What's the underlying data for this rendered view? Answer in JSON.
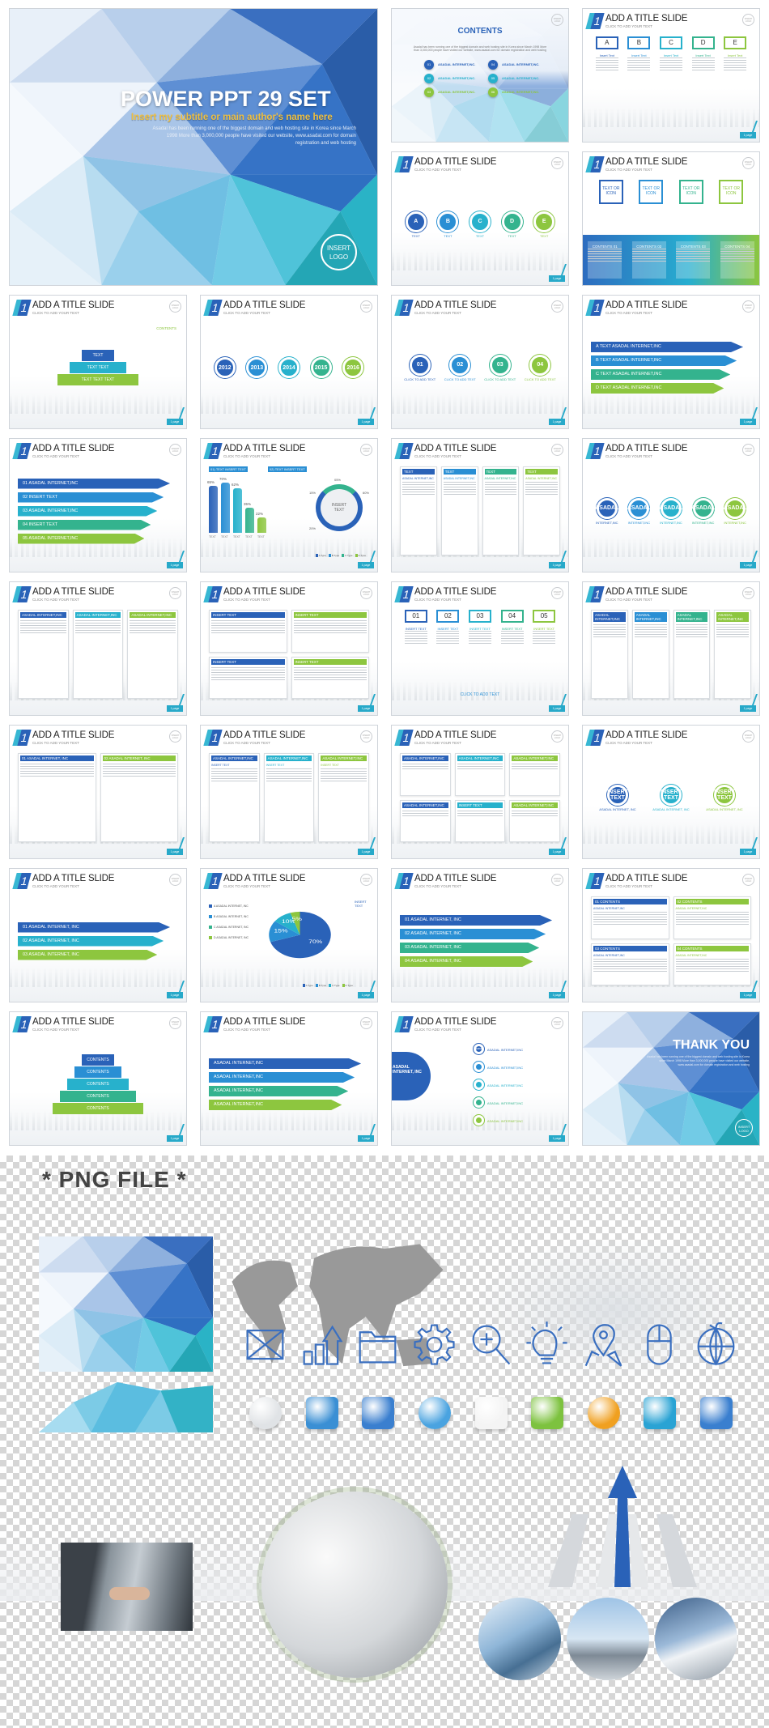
{
  "colors": {
    "accent": "#2a62b8",
    "palette": [
      "#2a62b8",
      "#2a8fd4",
      "#27b1cc",
      "#34b38e",
      "#8dc63f"
    ],
    "subtitle_gold": "#f0c040"
  },
  "cover": {
    "title": "POWER PPT 29 SET",
    "subtitle": "Insert my subtitle or main author's name here",
    "body": "Asadal has been running one of the biggest domain and web hosting site in Korea since March 1998 More than 3,000,000 people have visited our website, www.asadal.com for domain registration and web hosting",
    "logo": "INSERT LOGO"
  },
  "contents": {
    "title": "CONTENTS",
    "body": "Asadal has been running one of the biggest domain and web hosting site in Korea since March 1998 More than 3,000,000 people have visited our website, www.asadal.com for domain registration and web hosting",
    "logo": "INSERT LOGO",
    "items": [
      {
        "num": "01",
        "label": "ASADAL INTERNET,INC."
      },
      {
        "num": "02",
        "label": "ASADAL INTERNET,INC."
      },
      {
        "num": "03",
        "label": "ASADAL INTERNET,INC."
      },
      {
        "num": "04",
        "label": "ASADAL INTERNET,INC."
      },
      {
        "num": "05",
        "label": "ASADAL INTERNET,INC."
      },
      {
        "num": "06",
        "label": "ASADAL INTERNET,INC."
      }
    ]
  },
  "slide_header": {
    "number": "1",
    "title": "ADD A TITLE SLIDE",
    "subtitle": "CLICK TO ADD YOUR TEXT",
    "logo": "INSERT LOGO",
    "page": "1 page"
  },
  "slides": [
    {
      "variant": "boxes",
      "items": [
        "A",
        "B",
        "C",
        "D",
        "E"
      ],
      "caption": "Insert Text"
    },
    {
      "variant": "circles",
      "items": [
        "A",
        "B",
        "C",
        "D",
        "E"
      ],
      "caption": "TEXT"
    },
    {
      "variant": "band",
      "items": [
        "TEXT OR ICON",
        "TEXT OR ICON",
        "TEXT OR ICON",
        "TEXT OR ICON"
      ],
      "band": [
        "CONTENTS 01",
        "CONTENTS 02",
        "CONTENTS 03",
        "CONTENTS 04"
      ]
    },
    {
      "variant": "pyramid",
      "items": [
        "TEXT",
        "TEXT TEXT",
        "TEXT TEXT TEXT"
      ],
      "caption": "CONTENTS"
    },
    {
      "variant": "circles",
      "items": [
        "2012",
        "2013",
        "2014",
        "2015",
        "2016"
      ]
    },
    {
      "variant": "circles",
      "items": [
        "01",
        "02",
        "03",
        "04"
      ],
      "caption": "CLICK TO ADD TEXT"
    },
    {
      "variant": "list",
      "items": [
        "A  TEXT   ASADAL INTERNET,INC",
        "B  TEXT   ASADAL INTERNET,INC",
        "C  TEXT   ASADAL INTERNET,INC",
        "D  TEXT   ASADAL INTERNET,INC"
      ]
    },
    {
      "variant": "list",
      "items": [
        "01  ASADAL INTERNET,INC",
        "02  INSERT TEXT",
        "03  ASADAL INTERNET,INC",
        "04  INSERT TEXT",
        "05  ASADAL INTERNET,INC"
      ]
    },
    {
      "variant": "bars",
      "headers": [
        "01) TEXT  INSERT TEXT",
        "02) TEXT  INSERT TEXT"
      ],
      "bars": [
        {
          "label": "65%",
          "value": 65,
          "tick": "TEXT"
        },
        {
          "label": "70%",
          "value": 70,
          "tick": "TEXT"
        },
        {
          "label": "62%",
          "value": 62,
          "tick": "TEXT"
        },
        {
          "label": "35%",
          "value": 35,
          "tick": "TEXT"
        },
        {
          "label": "22%",
          "value": 22,
          "tick": "TEXT"
        }
      ],
      "ring": "INSERT TEXT",
      "ring_labels": [
        "05%",
        "60%",
        "15%",
        "20%"
      ],
      "legend": [
        "A Type",
        "B Type",
        "C Type",
        "D Type"
      ]
    },
    {
      "variant": "cards",
      "cols": 4,
      "items": [
        "TEXT",
        "TEXT",
        "TEXT",
        "TEXT"
      ],
      "caption": "ASADAL INTERNET,INC"
    },
    {
      "variant": "circles",
      "items": [
        "ASADAL",
        "ASADAL",
        "ASADAL",
        "ASADAL",
        "ASADAL"
      ],
      "caption": "INTERNET,INC"
    },
    {
      "variant": "cards",
      "cols": 3,
      "items": [
        "ASADAL INTERNET,INC",
        "ASADAL INTERNET,INC",
        "ASADAL INTERNET,INC"
      ]
    },
    {
      "variant": "cards",
      "cols": 2,
      "items": [
        "INSERT TEXT",
        "INSERT TEXT",
        "INSERT TEXT",
        "INSERT TEXT"
      ]
    },
    {
      "variant": "boxes",
      "items": [
        "01",
        "02",
        "03",
        "04",
        "05"
      ],
      "caption": "INSERT TEXT",
      "footer": "CLICK TO ADD TEXT"
    },
    {
      "variant": "cards",
      "cols": 4,
      "items": [
        "ASADAL INTERNET,INC",
        "ASADAL INTERNET,INC",
        "ASADAL INTERNET,INC",
        "ASADAL INTERNET,INC"
      ]
    },
    {
      "variant": "cards",
      "cols": 2,
      "items": [
        "01 ASADAL INTERNET, INC",
        "02 ASADAL INTERNET, INC"
      ]
    },
    {
      "variant": "cards",
      "cols": 3,
      "items": [
        "ASADAL INTERNET,INC",
        "ASADAL INTERNET,INC",
        "ASADAL INTERNET,INC"
      ],
      "caption": "INSERT TEXT"
    },
    {
      "variant": "cards",
      "cols": 3,
      "items": [
        "ASADAL INTERNET,INC",
        "ASADAL INTERNET,INC",
        "ASADAL INTERNET,INC",
        "ASADAL INTERNET,INC",
        "INSERT TEXT",
        "ASADAL INTERNET,INC"
      ]
    },
    {
      "variant": "circles",
      "items": [
        "INSERT TEXT",
        "INSERT TEXT",
        "INSERT TEXT"
      ],
      "caption": "ASADAL INTERNET, INC"
    },
    {
      "variant": "list",
      "items": [
        "01 ASADAL INTERNET, INC",
        "02 ASADAL INTERNET, INC",
        "03 ASADAL INTERNET, INC"
      ]
    },
    {
      "variant": "pie",
      "slices": [
        {
          "label": "70%",
          "value": 70
        },
        {
          "label": "15%",
          "value": 15
        },
        {
          "label": "10%",
          "value": 10
        },
        {
          "label": "5%",
          "value": 5
        }
      ],
      "callout": "INSERT TEXT",
      "rows": [
        "A  ASADAL INTERNET, INC",
        "B  ASADAL INTERNET, INC",
        "C  ASADAL INTERNET, INC",
        "D  ASADAL INTERNET, INC"
      ],
      "legend": [
        "A Type",
        "B Type",
        "C Type",
        "D Type"
      ]
    },
    {
      "variant": "list",
      "items": [
        "01   ASADAL INTERNET, INC",
        "02   ASADAL INTERNET, INC",
        "03   ASADAL INTERNET, INC",
        "04   ASADAL INTERNET, INC"
      ]
    },
    {
      "variant": "cards",
      "cols": 2,
      "items": [
        "01 CONTENTS",
        "02 CONTENTS",
        "03 CONTENTS",
        "04 CONTENTS"
      ],
      "caption": "ASADAL INTERNET,INC"
    },
    {
      "variant": "pyramid",
      "items": [
        "CONTENTS",
        "CONTENTS",
        "CONTENTS",
        "CONTENTS",
        "CONTENTS"
      ]
    },
    {
      "variant": "list",
      "items": [
        "ASADAL INTERNET,INC",
        "ASADAL INTERNET,INC",
        "ASADAL INTERNET,INC",
        "ASADAL INTERNET,INC"
      ]
    },
    {
      "variant": "circles",
      "items": [
        "ASADAL",
        "",
        "",
        "",
        ""
      ],
      "caption": "ASADAL INTERNET,INC",
      "center": "ASADAL INTERNET, INC"
    }
  ],
  "thank_you": {
    "title": "THANK YOU",
    "body": "Asadal has been running one of the biggest domain and web hosting site in Korea since March 1998 More than 3,000,000 people have visited our website, www.asadal.com for domain registration and web hosting",
    "logo": "INSERT LOGO"
  },
  "png_section": {
    "title": "* PNG FILE *",
    "line_icons": [
      "envelope-icon",
      "growth-chart-icon",
      "folder-icon",
      "gear-icon",
      "zoom-in-icon",
      "lightbulb-icon",
      "map-pin-icon",
      "mouse-icon",
      "globe-icon"
    ],
    "object_icons": [
      "clock-email-icon",
      "font-icon",
      "save-icon",
      "world-network-icon",
      "person-icon",
      "checkmark-icon",
      "bar-chart-icon",
      "pie-chart-icon",
      "column-chart-icon"
    ]
  }
}
